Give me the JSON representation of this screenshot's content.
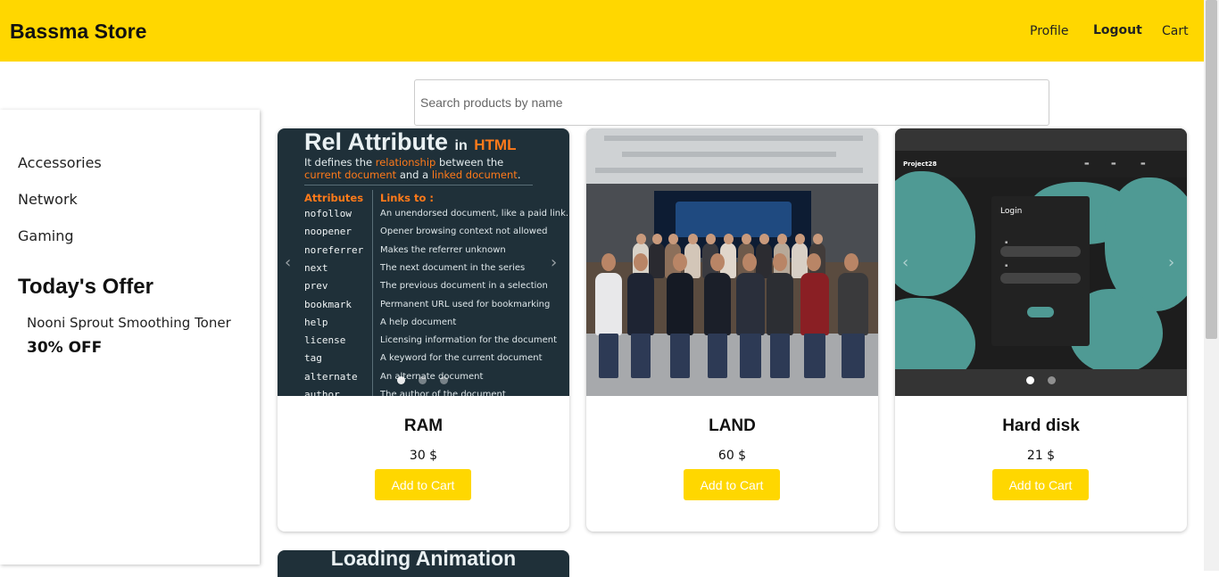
{
  "header": {
    "brand": "Bassma Store",
    "nav": {
      "profile": "Profile",
      "logout": "Logout",
      "cart": "Cart"
    },
    "bg_color": "#ffd700"
  },
  "search": {
    "placeholder": "Search products by name",
    "value": ""
  },
  "sidebar": {
    "categories": [
      "Accessories",
      "Network",
      "Gaming"
    ],
    "offer": {
      "title": "Today's Offer",
      "product": "Nooni Sprout Smoothing Toner",
      "discount": "30% OFF"
    }
  },
  "products": [
    {
      "name": "RAM",
      "price": "30 $",
      "button": "Add to Cart",
      "image": {
        "title": "Rel Attribute",
        "title_in": "in",
        "title_html": "HTML",
        "subtitle_1a": "It defines the ",
        "subtitle_1b": "relationship",
        "subtitle_1c": " between the",
        "subtitle_2a": "current document",
        "subtitle_2b": " and a ",
        "subtitle_2c": "linked document",
        "subtitle_2d": ".",
        "col_attributes": "Attributes",
        "col_links": "Links to :",
        "rows": [
          {
            "attr": "nofollow",
            "desc": "An unendorsed document, like a paid link."
          },
          {
            "attr": "noopener",
            "desc": "Opener browsing context not allowed"
          },
          {
            "attr": "noreferrer",
            "desc": "Makes the referrer unknown"
          },
          {
            "attr": "next",
            "desc": "The next document in the series"
          },
          {
            "attr": "prev",
            "desc": "The previous document in a selection"
          },
          {
            "attr": "bookmark",
            "desc": "Permanent URL used for bookmarking"
          },
          {
            "attr": "help",
            "desc": "A help document"
          },
          {
            "attr": "license",
            "desc": "Licensing information for the document"
          },
          {
            "attr": "tag",
            "desc": "A keyword for the current document"
          },
          {
            "attr": "alternate",
            "desc": "An alternate document"
          },
          {
            "attr": "author",
            "desc": "The author of the document"
          }
        ]
      }
    },
    {
      "name": "LAND",
      "price": "60 $",
      "button": "Add to Cart"
    },
    {
      "name": "Hard disk",
      "price": "21 $",
      "button": "Add to Cart",
      "image": {
        "brand": "Project28",
        "login_title": "Login"
      }
    },
    {
      "partial_image_title": "Loading Animation"
    }
  ],
  "carousel": {
    "prev": "‹",
    "next": "›"
  },
  "icons": [
    "chevron-left-icon",
    "chevron-right-icon"
  ]
}
